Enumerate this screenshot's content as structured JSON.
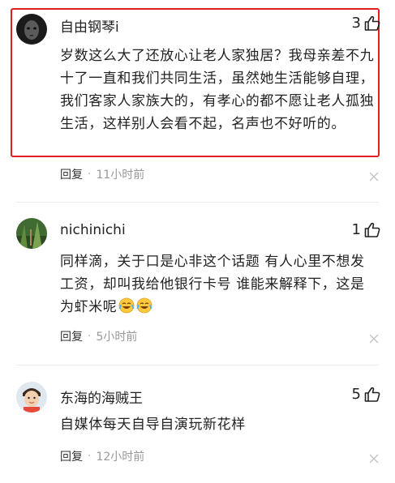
{
  "comments": [
    {
      "username": "自由钢琴i",
      "likes": "3",
      "content": "岁数这么大了还放心让老人家独居？我母亲差不九十了一直和我们共同生活，虽然她生活能够自理，我们客家人家族大的，有孝心的都不愿让老人孤独生活，这样别人会看不起，名声也不好听的。",
      "reply_label": "回复",
      "time": "11小时前",
      "highlighted": true
    },
    {
      "username": "nichinichi",
      "likes": "1",
      "content": "同样滴，关于口是心非这个话题 有人心里不想发工资，却叫我给他银行卡号 谁能来解释下，这是为虾米呢",
      "emoji_icons": [
        "laugh-cry-emoji",
        "laugh-cry-emoji"
      ],
      "reply_label": "回复",
      "time": "5小时前"
    },
    {
      "username": "东海的海贼王",
      "likes": "5",
      "content": "自媒体每天自导自演玩新花样",
      "reply_label": "回复",
      "time": "12小时前"
    }
  ],
  "meta_separator": "·",
  "icons": {
    "like": "thumbs-up-icon",
    "close": "close-icon"
  },
  "colors": {
    "highlight_border": "#e02020",
    "meta_text": "#999999",
    "emoji_face": "#ffc83d"
  }
}
